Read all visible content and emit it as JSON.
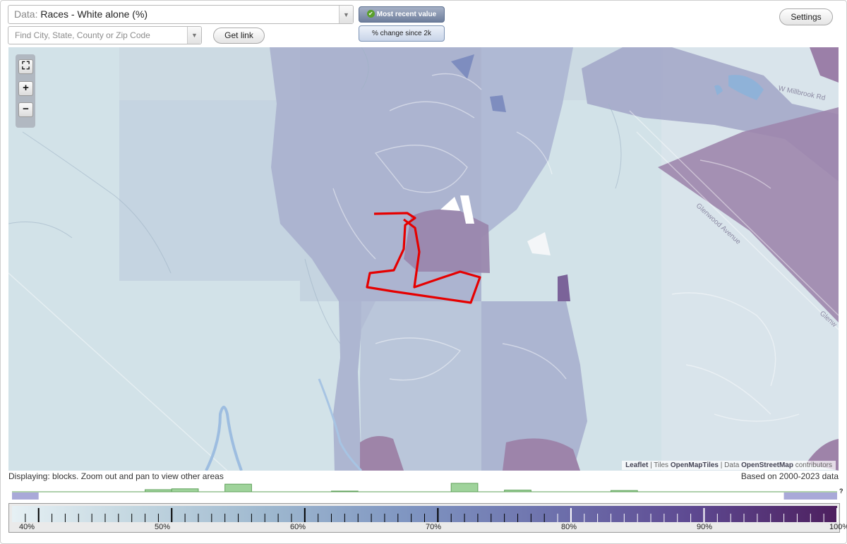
{
  "data_selector": {
    "prefix": "Data:",
    "value": "Races - White alone (%)"
  },
  "search": {
    "placeholder": "Find City, State, County or Zip Code"
  },
  "buttons": {
    "get_link": "Get link",
    "settings": "Settings"
  },
  "toggles": {
    "most_recent": "Most recent value",
    "percent_change": "% change since 2k"
  },
  "map": {
    "street_labels": [
      "W Millbrook Rd",
      "Glenwood Avenue",
      "Glenw"
    ],
    "attribution": {
      "leaflet": "Leaflet",
      "tiles_label": "Tiles",
      "tiles": "OpenMapTiles",
      "data_label": "Data",
      "data": "OpenStreetMap",
      "contributors": "contributors"
    },
    "zoom": {
      "fit": "⛶",
      "in": "+",
      "out": "−"
    }
  },
  "status": {
    "displaying": "Displaying: blocks. Zoom out and pan to view other areas",
    "based_on": "Based on 2000-2023 data"
  },
  "legend": {
    "help": "?",
    "tick_labels": [
      "40%",
      "50%",
      "60%",
      "70%",
      "80%",
      "90%",
      "100%"
    ],
    "min": 38,
    "max": 100
  },
  "histogram": {
    "bins": [
      {
        "from": 38,
        "to": 40,
        "value": 0.9
      },
      {
        "from": 48,
        "to": 50,
        "value": 0.25
      },
      {
        "from": 50,
        "to": 52,
        "value": 0.35
      },
      {
        "from": 54,
        "to": 56,
        "value": 0.9
      },
      {
        "from": 62,
        "to": 64,
        "value": 0.08
      },
      {
        "from": 71,
        "to": 73,
        "value": 1.0
      },
      {
        "from": 75,
        "to": 77,
        "value": 0.2
      },
      {
        "from": 83,
        "to": 85,
        "value": 0.15
      },
      {
        "from": 96,
        "to": 100,
        "value": 0.9
      }
    ]
  },
  "colors": {
    "highlight": "#e60000",
    "histogram_bar": "#9fd39b",
    "histogram_low": "#a9a9d8"
  }
}
